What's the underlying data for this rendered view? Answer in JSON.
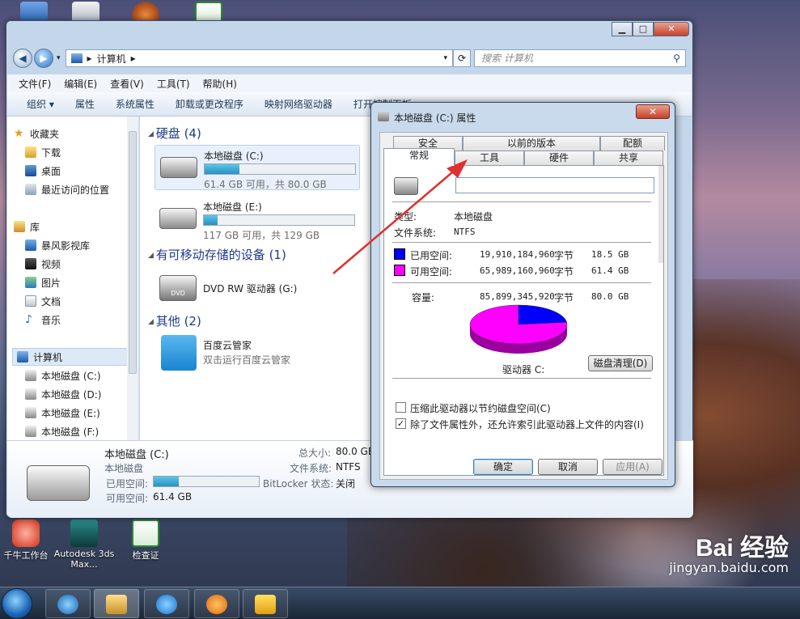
{
  "desktop": {
    "icons": [
      {
        "label": "千牛工作台"
      },
      {
        "label": "Autodesk 3ds Max..."
      },
      {
        "label": "检查证"
      }
    ]
  },
  "explorer": {
    "breadcrumb": "计算机",
    "search_placeholder": "搜索 计算机",
    "menu": [
      "文件(F)",
      "编辑(E)",
      "查看(V)",
      "工具(T)",
      "帮助(H)"
    ],
    "toolbar": [
      "组织 ▾",
      "属性",
      "系统属性",
      "卸载或更改程序",
      "映射网络驱动器",
      "打开控制面板"
    ],
    "sidebar": {
      "favorites": "收藏夹",
      "fav_items": [
        "下载",
        "桌面",
        "最近访问的位置"
      ],
      "libraries": "库",
      "lib_items": [
        "暴风影视库",
        "视频",
        "图片",
        "文档",
        "音乐"
      ],
      "computer": "计算机",
      "drives": [
        "本地磁盘 (C:)",
        "本地磁盘 (D:)",
        "本地磁盘 (E:)",
        "本地磁盘 (F:)"
      ]
    },
    "groups": {
      "hdd": "硬盘 (4)",
      "removable": "有可移动存储的设备 (1)",
      "other": "其他 (2)"
    },
    "drives": [
      {
        "name": "本地磁盘 (C:)",
        "sub": "61.4 GB 可用，共 80.0 GB",
        "used_fraction": 0.23
      },
      {
        "name": "本地磁盘 (E:)",
        "sub": "117 GB 可用，共 129 GB",
        "used_fraction": 0.09
      }
    ],
    "dvd": {
      "name": "DVD RW 驱动器 (G:)",
      "icon_text": "DVD"
    },
    "app": {
      "name": "百度云管家",
      "sub": "双击运行百度云管家"
    },
    "details": {
      "title": "本地磁盘 (C:)",
      "type": "本地磁盘",
      "used_label": "已用空间:",
      "free_label": "可用空间:",
      "free_value": "61.4 GB",
      "total_label": "总大小:",
      "total_value": "80.0 GB",
      "fs_label": "文件系统:",
      "fs_value": "NTFS",
      "bitlocker_label": "BitLocker 状态:",
      "bitlocker_value": "关闭",
      "used_fraction": 0.24
    }
  },
  "dialog": {
    "title": "本地磁盘 (C:) 属性",
    "close": "✕",
    "tabs_top": [
      "安全",
      "以前的版本",
      "配额"
    ],
    "tabs_bottom": [
      "常规",
      "工具",
      "硬件",
      "共享"
    ],
    "type_label": "类型:",
    "type_value": "本地磁盘",
    "fs_label": "文件系统:",
    "fs_value": "NTFS",
    "used": {
      "label": "已用空间:",
      "bytes": "19,910,184,960",
      "unit": "字节",
      "size": "18.5 GB",
      "color": "#0000ff"
    },
    "free": {
      "label": "可用空间:",
      "bytes": "65,989,160,960",
      "unit": "字节",
      "size": "61.4 GB",
      "color": "#ff00ff"
    },
    "capacity": {
      "label": "容量:",
      "bytes": "85,899,345,920",
      "unit": "字节",
      "size": "80.0 GB"
    },
    "drive_label": "驱动器 C:",
    "cleanup": "磁盘清理(D)",
    "compress": "压缩此驱动器以节约磁盘空间(C)",
    "index": "除了文件属性外，还允许索引此驱动器上文件的内容(I)",
    "index_checked": "✓",
    "ok": "确定",
    "cancel": "取消",
    "apply": "应用(A)"
  },
  "watermark": {
    "brand": "Bai 经验",
    "url": "jingyan.baidu.com"
  }
}
